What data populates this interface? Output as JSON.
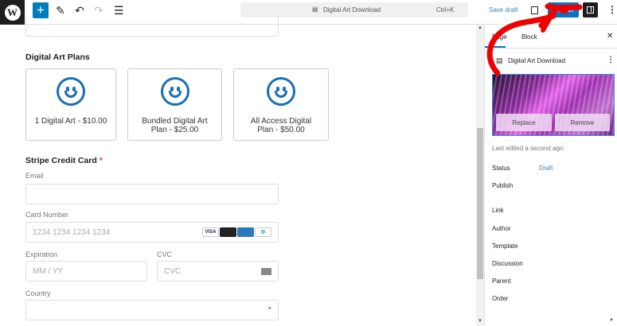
{
  "toolbar": {
    "doc_title": "Digital Art Download",
    "shortcut": "Ctrl+K",
    "save_draft": "Save draft",
    "publish": "Publish"
  },
  "main": {
    "plans_heading": "Digital Art Plans",
    "plans": [
      {
        "label": "1 Digital Art - $10.00"
      },
      {
        "label": "Bundled Digital Art Plan - $25.00"
      },
      {
        "label": "All Access Digital Plan - $50.00"
      }
    ],
    "stripe_heading": "Stripe Credit Card",
    "required_mark": "*",
    "email_label": "Email",
    "card_label": "Card Number",
    "card_placeholder": "1234 1234 1234 1234",
    "card_brands": [
      "VISA",
      "Mastercard",
      "Amex",
      "Diners"
    ],
    "exp_label": "Expiration",
    "exp_placeholder": "MM / YY",
    "cvc_label": "CVC",
    "cvc_placeholder": "CVC",
    "country_label": "Country"
  },
  "sidebar": {
    "tabs": [
      "Page",
      "Block"
    ],
    "title": "Digital Art Download",
    "replace": "Replace",
    "remove": "Remove",
    "last_edited": "Last edited a second ago.",
    "status_label": "Status",
    "status_value": "Draft",
    "rows": [
      "Publish",
      "Link",
      "Author",
      "Template",
      "Discussion",
      "Parent",
      "Order"
    ]
  },
  "colors": {
    "accent": "#007cba",
    "annotation": "#ee0000"
  }
}
